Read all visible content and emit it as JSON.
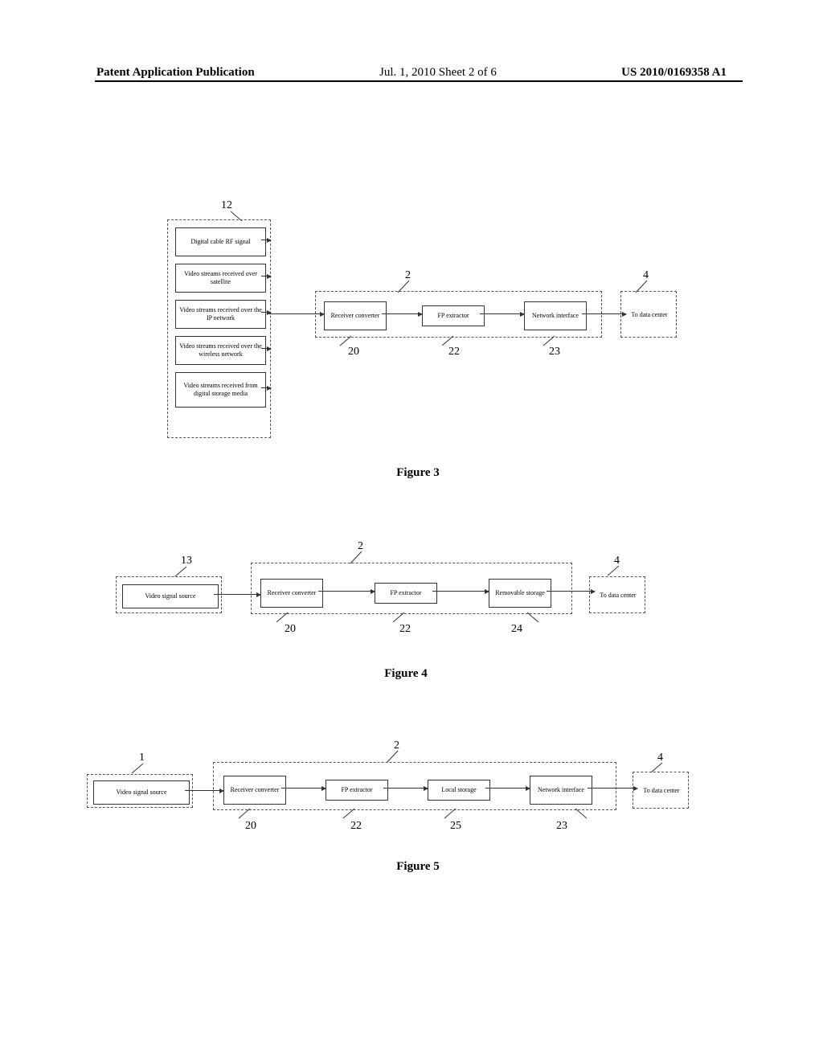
{
  "header": {
    "left": "Patent Application Publication",
    "center": "Jul. 1, 2010   Sheet 2 of 6",
    "right": "US 2010/0169358 A1"
  },
  "fig3": {
    "sources_group_label": "12",
    "sources": [
      "Digital cable RF signal",
      "Video streams received over satellite",
      "Video streams received over the IP network",
      "Video streams received over the wireless network",
      "Video streams received from digital storage media"
    ],
    "proc_group_label": "2",
    "blocks": {
      "b20": {
        "label": "Receiver converter",
        "num": "20"
      },
      "b22": {
        "label": "FP extractor",
        "num": "22"
      },
      "b23": {
        "label": "Network interface",
        "num": "23"
      }
    },
    "out_group_label": "4",
    "out": "To data center",
    "caption": "Figure 3"
  },
  "fig4": {
    "source_group_label": "13",
    "source": "Video signal source",
    "proc_group_label": "2",
    "blocks": {
      "b20": {
        "label": "Receiver converter",
        "num": "20"
      },
      "b22": {
        "label": "FP extractor",
        "num": "22"
      },
      "b24": {
        "label": "Removable storage",
        "num": "24"
      }
    },
    "out_group_label": "4",
    "out": "To data center",
    "caption": "Figure 4"
  },
  "fig5": {
    "source_group_label": "1",
    "source": "Video signal source",
    "proc_group_label": "2",
    "blocks": {
      "b20": {
        "label": "Receiver converter",
        "num": "20"
      },
      "b22": {
        "label": "FP extractor",
        "num": "22"
      },
      "b25": {
        "label": "Local storage",
        "num": "25"
      },
      "b23": {
        "label": "Network interface",
        "num": "23"
      }
    },
    "out_group_label": "4",
    "out": "To data center",
    "caption": "Figure 5"
  },
  "chart_data": [
    {
      "type": "diagram",
      "name": "Figure 3",
      "nodes": [
        {
          "id": "src_group",
          "label": "video sources (12)",
          "children": [
            "Digital cable RF signal",
            "Video streams received over satellite",
            "Video streams received over the IP network",
            "Video streams received over the wireless network",
            "Video streams received from digital storage media"
          ]
        },
        {
          "id": "proc_group",
          "label": "processing (2)",
          "children": [
            {
              "id": "20",
              "label": "Receiver converter"
            },
            {
              "id": "22",
              "label": "FP extractor"
            },
            {
              "id": "23",
              "label": "Network interface"
            }
          ]
        },
        {
          "id": "out_group",
          "label": "output (4)",
          "children": [
            {
              "id": "out",
              "label": "To data center"
            }
          ]
        }
      ],
      "edges": [
        [
          "src_group",
          "20"
        ],
        [
          "20",
          "22"
        ],
        [
          "22",
          "23"
        ],
        [
          "23",
          "out"
        ]
      ]
    },
    {
      "type": "diagram",
      "name": "Figure 4",
      "nodes": [
        {
          "id": "13",
          "label": "Video signal source"
        },
        {
          "id": "proc_group",
          "label": "processing (2)",
          "children": [
            {
              "id": "20",
              "label": "Receiver converter"
            },
            {
              "id": "22",
              "label": "FP extractor"
            },
            {
              "id": "24",
              "label": "Removable storage"
            }
          ]
        },
        {
          "id": "out_group",
          "label": "output (4)",
          "children": [
            {
              "id": "out",
              "label": "To data center"
            }
          ]
        }
      ],
      "edges": [
        [
          "13",
          "20"
        ],
        [
          "20",
          "22"
        ],
        [
          "22",
          "24"
        ],
        [
          "24",
          "out"
        ]
      ]
    },
    {
      "type": "diagram",
      "name": "Figure 5",
      "nodes": [
        {
          "id": "1",
          "label": "Video signal source"
        },
        {
          "id": "proc_group",
          "label": "processing (2)",
          "children": [
            {
              "id": "20",
              "label": "Receiver converter"
            },
            {
              "id": "22",
              "label": "FP extractor"
            },
            {
              "id": "25",
              "label": "Local storage"
            },
            {
              "id": "23",
              "label": "Network interface"
            }
          ]
        },
        {
          "id": "out_group",
          "label": "output (4)",
          "children": [
            {
              "id": "out",
              "label": "To data center"
            }
          ]
        }
      ],
      "edges": [
        [
          "1",
          "20"
        ],
        [
          "20",
          "22"
        ],
        [
          "22",
          "25"
        ],
        [
          "25",
          "23"
        ],
        [
          "23",
          "out"
        ]
      ]
    }
  ]
}
